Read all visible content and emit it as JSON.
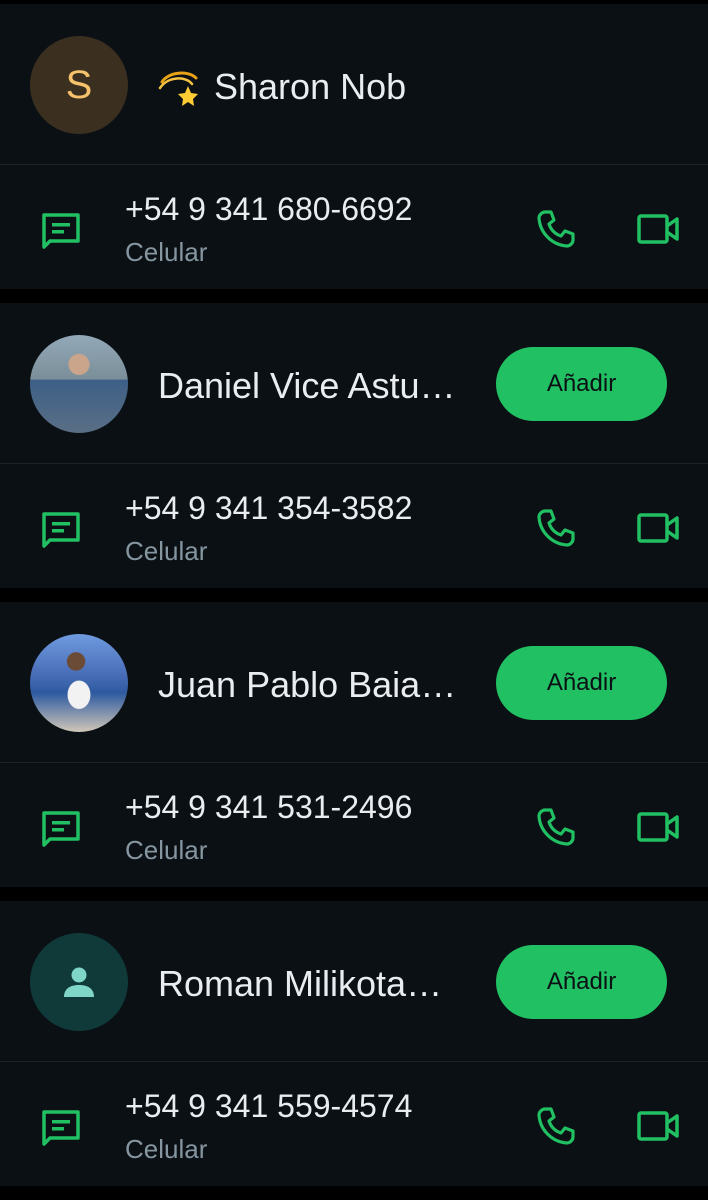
{
  "colors": {
    "background": "#0b1014",
    "separator": "#000000",
    "accent": "#21c063",
    "text_primary": "#e9edef",
    "text_secondary": "#8696a0"
  },
  "contacts": [
    {
      "name": "Sharon Nob",
      "avatar_letter": "S",
      "name_prefix_icon": "shooting-star-emoji",
      "phone": "+54 9 341 680-6692",
      "phone_type": "Celular"
    },
    {
      "name": "Daniel Vice Astu…",
      "add_label": "Añadir",
      "phone": "+54 9 341 354-3582",
      "phone_type": "Celular"
    },
    {
      "name": "Juan Pablo Baia…",
      "add_label": "Añadir",
      "phone": "+54 9 341 531-2496",
      "phone_type": "Celular"
    },
    {
      "name": "Roman Milikota…",
      "add_label": "Añadir",
      "phone": "+54 9 341 559-4574",
      "phone_type": "Celular"
    }
  ],
  "icons": {
    "message": "message-icon",
    "call": "phone-icon",
    "video": "video-call-icon",
    "default_avatar": "person-icon"
  }
}
